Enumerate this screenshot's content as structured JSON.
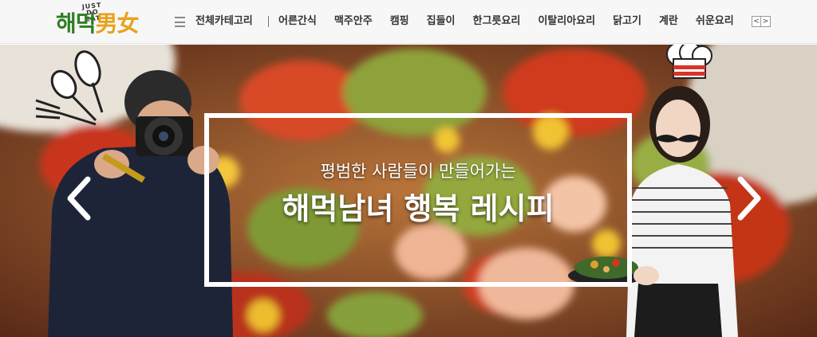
{
  "logo": {
    "tagline": "JUST DO EAT",
    "name_part1": "해먹",
    "name_part2": "男女"
  },
  "nav": {
    "all_categories": "전체카테고리",
    "categories": [
      "어른간식",
      "맥주안주",
      "캠핑",
      "집들이",
      "한그릇요리",
      "이탈리아요리",
      "닭고기",
      "계란",
      "쉬운요리"
    ],
    "prev_arrow": "<",
    "next_arrow": ">"
  },
  "hero": {
    "subtitle": "평범한 사람들이 만들어가는",
    "title": "해먹남녀 행복 레시피"
  },
  "colors": {
    "logo_green": "#2f7d24",
    "logo_orange": "#e8a21b",
    "frame": "#ffffff"
  }
}
